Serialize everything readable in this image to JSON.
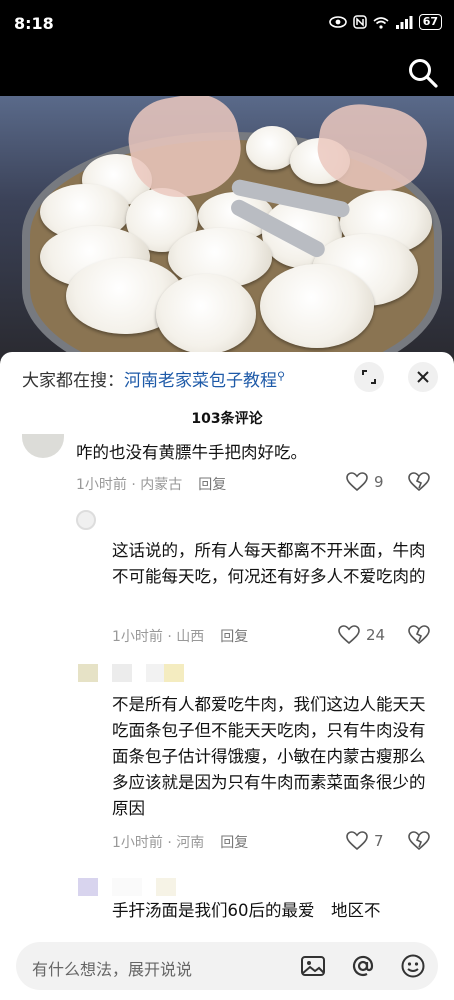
{
  "status_bar": {
    "time": "8:18",
    "battery": "67"
  },
  "header": {
    "search_icon": "search-icon"
  },
  "video": {
    "side_tab_icons": [
      "chevron-left-icon",
      "red-packet-icon"
    ]
  },
  "search_hint": {
    "prefix": "大家都在搜：",
    "query": "河南老家菜包子教程"
  },
  "comments_header": {
    "count_label": "103条评论"
  },
  "comments": [
    {
      "text": "咋的也没有黄膘牛手把肉好吃。",
      "time": "1小时前",
      "location": "内蒙古",
      "reply": "回复",
      "likes": "9"
    },
    {
      "text": "这话说的，所有人每天都离不开米面，牛肉不可能每天吃，何况还有好多人不爱吃肉的",
      "time": "1小时前",
      "location": "山西",
      "reply": "回复",
      "likes": "24"
    },
    {
      "text": "不是所有人都爱吃牛肉，我们这边人能天天吃面条包子但不能天天吃肉，只有牛肉没有面条包子估计得饿瘦，小敏在内蒙古瘦那么多应该就是因为只有牛肉而素菜面条很少的原因",
      "time": "1小时前",
      "location": "河南",
      "reply": "回复",
      "likes": "7"
    },
    {
      "text": "手扞汤面是我们60后的最爱　地区不"
    }
  ],
  "input_bar": {
    "placeholder": "有什么想法，展开说说"
  },
  "colors": {
    "link": "#1e5aa8",
    "meta": "#999999",
    "sheet_bg": "#ffffff"
  }
}
